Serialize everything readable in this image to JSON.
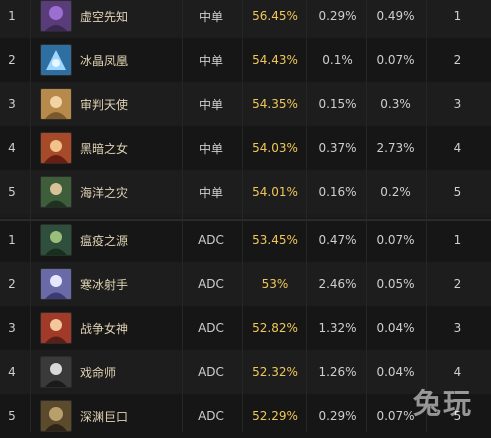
{
  "table": {
    "rows": [
      {
        "rank": "1",
        "name": "虚空先知",
        "role": "中单",
        "win_rate": "56.45%",
        "pick_rate": "0.29%",
        "ban_rate": "0.49%",
        "rank2": "1",
        "avatar_color": "#5a3c7a"
      },
      {
        "rank": "2",
        "name": "冰晶凤凰",
        "role": "中单",
        "win_rate": "54.43%",
        "pick_rate": "0.1%",
        "ban_rate": "0.07%",
        "rank2": "2",
        "avatar_color": "#2f6ea0"
      },
      {
        "rank": "3",
        "name": "审判天使",
        "role": "中单",
        "win_rate": "54.35%",
        "pick_rate": "0.15%",
        "ban_rate": "0.3%",
        "rank2": "3",
        "avatar_color": "#b78a4b"
      },
      {
        "rank": "4",
        "name": "黑暗之女",
        "role": "中单",
        "win_rate": "54.03%",
        "pick_rate": "0.37%",
        "ban_rate": "2.73%",
        "rank2": "4",
        "avatar_color": "#a64a2a"
      },
      {
        "rank": "5",
        "name": "海洋之灾",
        "role": "中单",
        "win_rate": "54.01%",
        "pick_rate": "0.16%",
        "ban_rate": "0.2%",
        "rank2": "5",
        "avatar_color": "#3e5d3a"
      },
      {
        "rank": "1",
        "name": "瘟疫之源",
        "role": "ADC",
        "win_rate": "53.45%",
        "pick_rate": "0.47%",
        "ban_rate": "0.07%",
        "rank2": "1",
        "avatar_color": "#2f4e3c"
      },
      {
        "rank": "2",
        "name": "寒冰射手",
        "role": "ADC",
        "win_rate": "53%",
        "pick_rate": "2.46%",
        "ban_rate": "0.05%",
        "rank2": "2",
        "avatar_color": "#6b6aa8"
      },
      {
        "rank": "3",
        "name": "战争女神",
        "role": "ADC",
        "win_rate": "52.82%",
        "pick_rate": "1.32%",
        "ban_rate": "0.04%",
        "rank2": "3",
        "avatar_color": "#a13a28"
      },
      {
        "rank": "4",
        "name": "戏命师",
        "role": "ADC",
        "win_rate": "52.32%",
        "pick_rate": "1.26%",
        "ban_rate": "0.04%",
        "rank2": "4",
        "avatar_color": "#3a3a3a"
      },
      {
        "rank": "5",
        "name": "深渊巨口",
        "role": "ADC",
        "win_rate": "52.29%",
        "pick_rate": "0.29%",
        "ban_rate": "0.07%",
        "rank2": "5",
        "avatar_color": "#5c4a2c"
      }
    ]
  },
  "watermark": {
    "text": "兔玩"
  },
  "colors": {
    "win_rate": "#f0c85a",
    "name": "#e0d2b4",
    "text": "#cfcfcf",
    "background": "#1b1b1b"
  }
}
